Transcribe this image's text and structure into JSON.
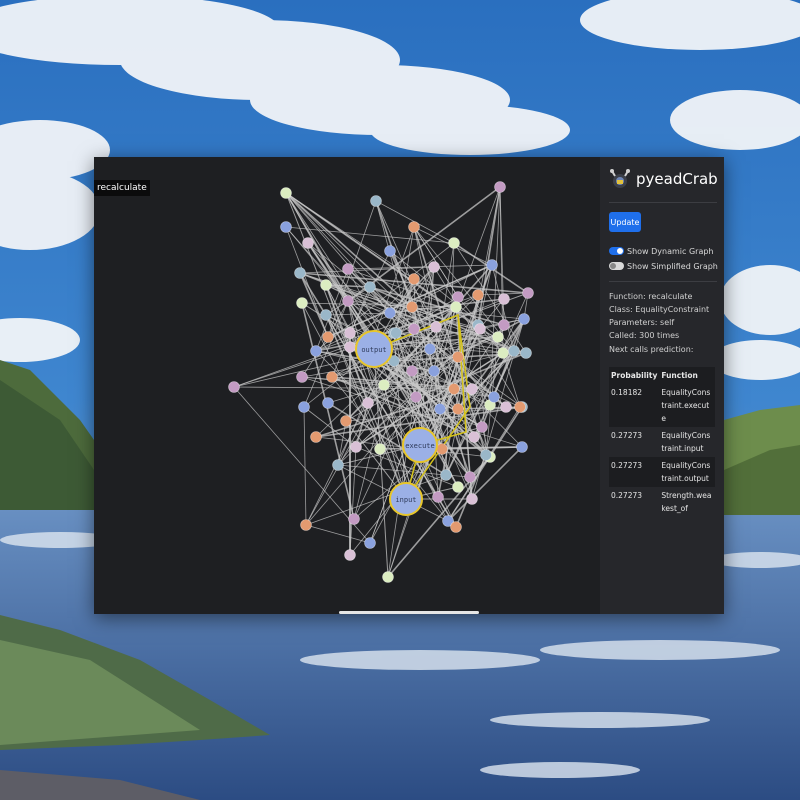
{
  "window": {
    "function_tag": "recalculate"
  },
  "sidebar": {
    "brand": "pyeadCrab",
    "update_label": "Update",
    "toggles": [
      {
        "label": "Show Dynamic Graph",
        "on": true
      },
      {
        "label": "Show Simplified Graph",
        "on": false
      }
    ],
    "info": {
      "function": "Function: recalculate",
      "class": "Class: EqualityConstraint",
      "parameters": "Parameters: self",
      "called": "Called: 300 times",
      "next_calls": "Next calls prediction:"
    },
    "table": {
      "headers": [
        "Probability",
        "Function"
      ],
      "rows": [
        {
          "prob": "0.18182",
          "func": "EqualityConstraint.execute"
        },
        {
          "prob": "0.27273",
          "func": "EqualityConstraint.input"
        },
        {
          "prob": "0.27273",
          "func": "EqualityConstraint.output"
        },
        {
          "prob": "0.27273",
          "func": "Strength.weakest_of"
        }
      ]
    }
  },
  "graph": {
    "highlighted_nodes": [
      {
        "label": "output"
      },
      {
        "label": "execute"
      },
      {
        "label": "input"
      }
    ],
    "colors": {
      "background": "#1e1f22",
      "edge": "#c8c8c8",
      "highlight_edge": "#d4c21a",
      "highlight_node_fill": "#9bb0e6",
      "highlight_node_stroke": "#e8c62a",
      "node_palette": [
        "#dcedc1",
        "#9ab7c9",
        "#c39bc3",
        "#8aa1de",
        "#e39a70",
        "#d9c0d6"
      ]
    }
  }
}
